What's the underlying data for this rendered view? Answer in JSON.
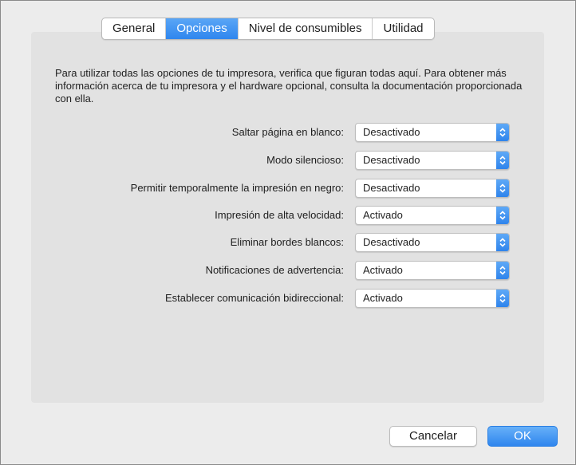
{
  "tabs": [
    {
      "label": "General",
      "selected": false
    },
    {
      "label": "Opciones",
      "selected": true
    },
    {
      "label": "Nivel de consumibles",
      "selected": false
    },
    {
      "label": "Utilidad",
      "selected": false
    }
  ],
  "description": "Para utilizar todas las opciones de tu impresora, verifica que figuran todas aquí. Para obtener más información acerca de tu impresora y el hardware opcional, consulta la documentación proporcionada con ella.",
  "options": [
    {
      "label": "Saltar página en blanco:",
      "value": "Desactivado"
    },
    {
      "label": "Modo silencioso:",
      "value": "Desactivado"
    },
    {
      "label": "Permitir temporalmente la impresión en negro:",
      "value": "Desactivado"
    },
    {
      "label": "Impresión de alta velocidad:",
      "value": "Activado"
    },
    {
      "label": "Eliminar bordes blancos:",
      "value": "Desactivado"
    },
    {
      "label": "Notificaciones de advertencia:",
      "value": "Activado"
    },
    {
      "label": "Establecer comunicación bidireccional:",
      "value": "Activado"
    }
  ],
  "buttons": {
    "cancel": "Cancelar",
    "ok": "OK"
  },
  "colors": {
    "accent": "#2f86ee",
    "panel": "#e2e2e2",
    "window": "#ececec"
  }
}
